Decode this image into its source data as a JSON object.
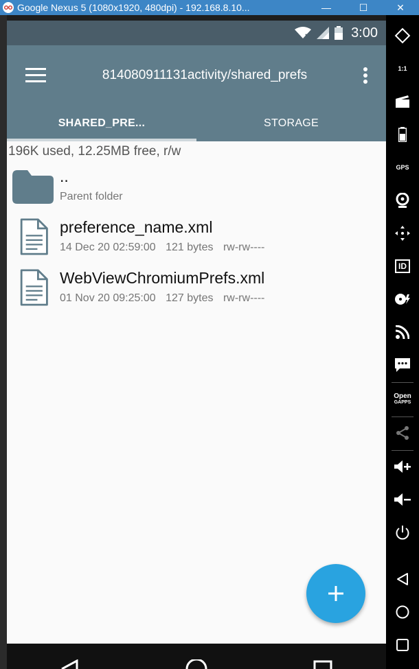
{
  "window": {
    "title": "Google Nexus 5 (1080x1920, 480dpi) - 192.168.8.10...",
    "minimize": "—",
    "maximize": "☐",
    "close": "✕"
  },
  "statusbar": {
    "time": "3:00"
  },
  "toolbar": {
    "path": "814080911131activity/shared_prefs"
  },
  "tabs": [
    {
      "label": "SHARED_PRE..."
    },
    {
      "label": "STORAGE"
    }
  ],
  "storage_usage": "196K used, 12.25MB free, r/w",
  "files": [
    {
      "name": "..",
      "subtitle": "Parent folder",
      "type": "folder"
    },
    {
      "name": "preference_name.xml",
      "date": "14 Dec 20 02:59:00",
      "size": "121 bytes",
      "perms": "rw-rw----",
      "type": "file"
    },
    {
      "name": "WebViewChromiumPrefs.xml",
      "date": "01 Nov 20 09:25:00",
      "size": "127 bytes",
      "perms": "rw-rw----",
      "type": "file"
    }
  ],
  "emulator_sidebar": {
    "gps_label": "GPS",
    "id_label": "ID",
    "opengapps_label_1": "Open",
    "opengapps_label_2": "GAPPS",
    "scale_label": "1:1"
  },
  "colors": {
    "toolbar": "#607d8b",
    "statusbar": "#4a5d69",
    "fab": "#29a3e0",
    "titlebar": "#3d86c6"
  }
}
